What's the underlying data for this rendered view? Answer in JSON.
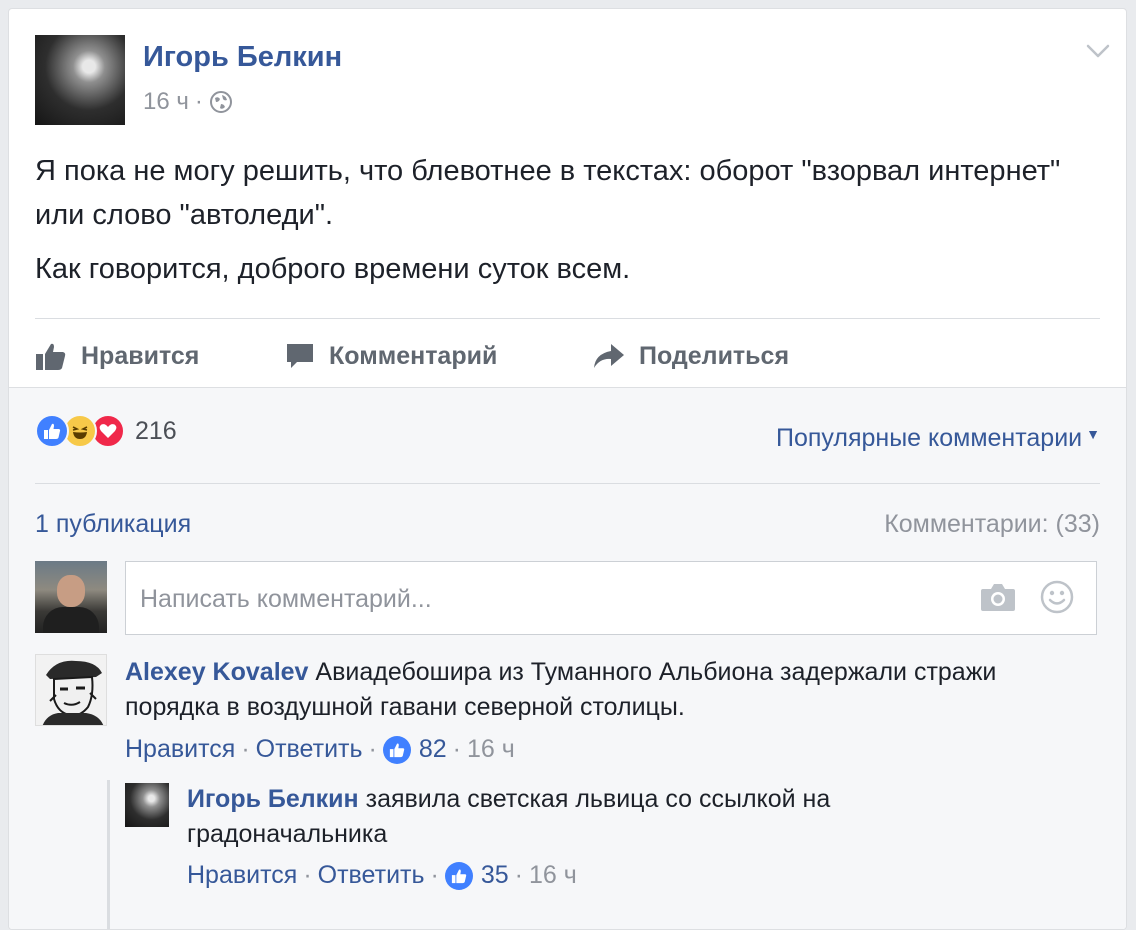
{
  "post": {
    "author": "Игорь Белкин",
    "time": "16 ч",
    "meta_separator": "·",
    "paragraphs": [
      "Я пока не могу решить, что блевотнее в текстах: оборот \"взорвал интернет\" или слово \"автоледи\".",
      "Как говорится, доброго времени суток всем."
    ]
  },
  "actions": {
    "like": "Нравится",
    "comment": "Комментарий",
    "share": "Поделиться"
  },
  "reactions": {
    "count": "216",
    "icons": [
      "like-icon",
      "haha-icon",
      "love-icon"
    ],
    "colors": {
      "like": "#4080ff",
      "haha": "#f7c949",
      "love": "#f0284a"
    }
  },
  "sort_label": "Популярные комментарии",
  "publications": "1 публикация",
  "comments_count": "Комментарии: (33)",
  "composer": {
    "placeholder": "Написать комментарий..."
  },
  "comments": [
    {
      "author": "Alexey Kovalev",
      "text": "Авиадебошира из Туманного Альбиона задержали стражи порядка в воздушной гавани северной столицы.",
      "like_label": "Нравится",
      "reply_label": "Ответить",
      "likes": "82",
      "time": "16 ч",
      "replies": [
        {
          "author": "Игорь Белкин",
          "text": "заявила светская львица со ссылкой на градоначальника",
          "like_label": "Нравится",
          "reply_label": "Ответить",
          "likes": "35",
          "time": "16 ч"
        }
      ]
    }
  ],
  "separator": "·",
  "colors": {
    "link": "#365899",
    "muted": "#90949c",
    "text": "#1d2129",
    "background": "#e9ebee"
  }
}
